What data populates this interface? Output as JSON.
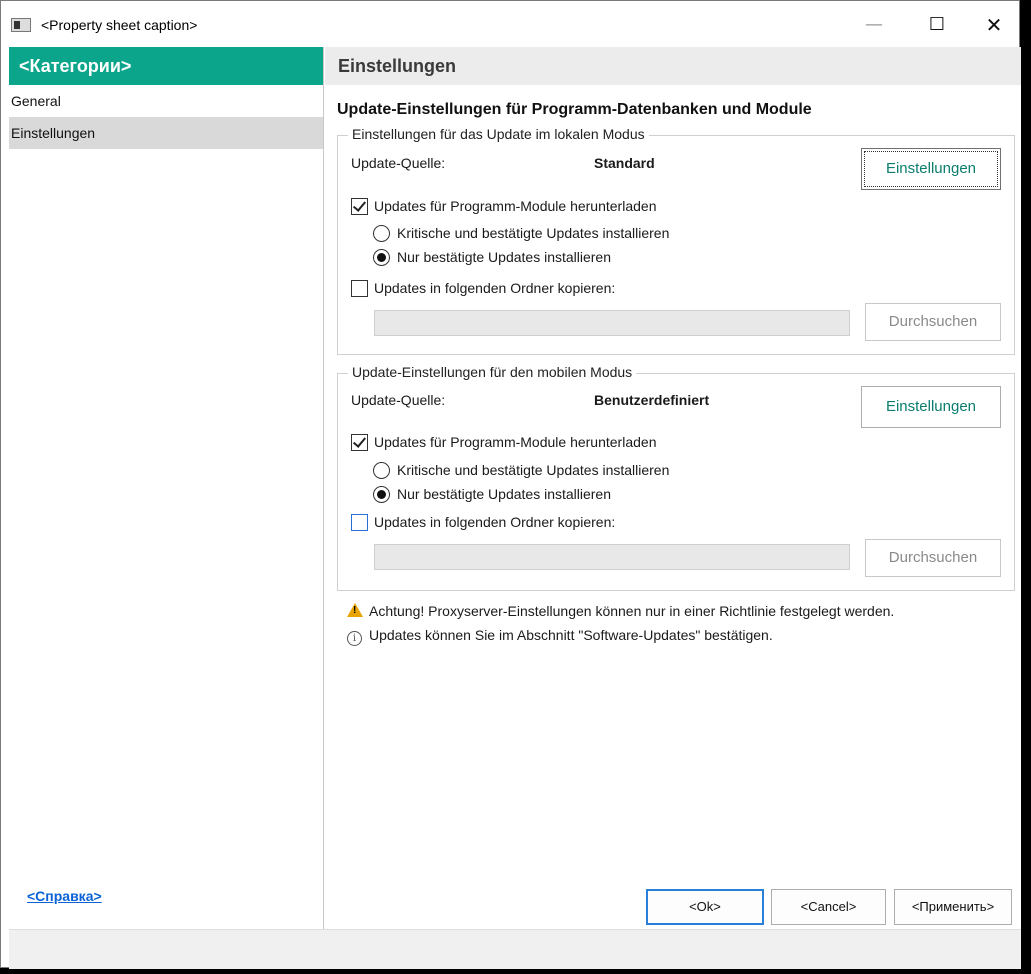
{
  "window": {
    "title": "<Property sheet caption>"
  },
  "sidebar": {
    "header": "<Категории>",
    "items": [
      {
        "label": "General",
        "selected": false
      },
      {
        "label": "Einstellungen",
        "selected": true
      }
    ]
  },
  "content": {
    "header": "Einstellungen",
    "title": "Update-Einstellungen für Programm-Datenbanken und Module",
    "local": {
      "group_title": "Einstellungen für das Update im lokalen Modus",
      "source_label": "Update-Quelle:",
      "source_value": "Standard",
      "settings_button": "Einstellungen",
      "download_modules": "Updates für Programm-Module herunterladen",
      "download_modules_checked": true,
      "radio_critical": "Kritische und bestätigte Updates installieren",
      "radio_approved": "Nur bestätigte Updates installieren",
      "selected_radio": "approved",
      "copy_folder": "Updates in folgenden Ordner kopieren:",
      "copy_folder_checked": false,
      "folder_path": "",
      "browse_button": "Durchsuchen"
    },
    "mobile": {
      "group_title": "Update-Einstellungen für den mobilen Modus",
      "source_label": "Update-Quelle:",
      "source_value": "Benutzerdefiniert",
      "settings_button": "Einstellungen",
      "download_modules": "Updates für Programm-Module herunterladen",
      "download_modules_checked": true,
      "radio_critical": "Kritische und bestätigte Updates installieren",
      "radio_approved": "Nur bestätigte Updates installieren",
      "selected_radio": "approved",
      "copy_folder": "Updates in folgenden Ordner kopieren:",
      "copy_folder_checked": false,
      "folder_path": "",
      "browse_button": "Durchsuchen"
    },
    "warning": "Achtung! Proxyserver-Einstellungen können nur in einer Richtlinie festgelegt werden.",
    "info": "Updates können Sie im Abschnitt \"Software-Updates\" bestätigen."
  },
  "footer": {
    "help": "<Справка>",
    "ok": "<Ok>",
    "cancel": "<Cancel>",
    "apply": "<Применить>"
  },
  "colors": {
    "accent": "#0aa58a",
    "link": "#0a62d6"
  },
  "icons": [
    "app-icon",
    "minimize-icon",
    "maximize-icon",
    "close-icon",
    "checkmark-icon",
    "warning-icon",
    "info-icon"
  ]
}
